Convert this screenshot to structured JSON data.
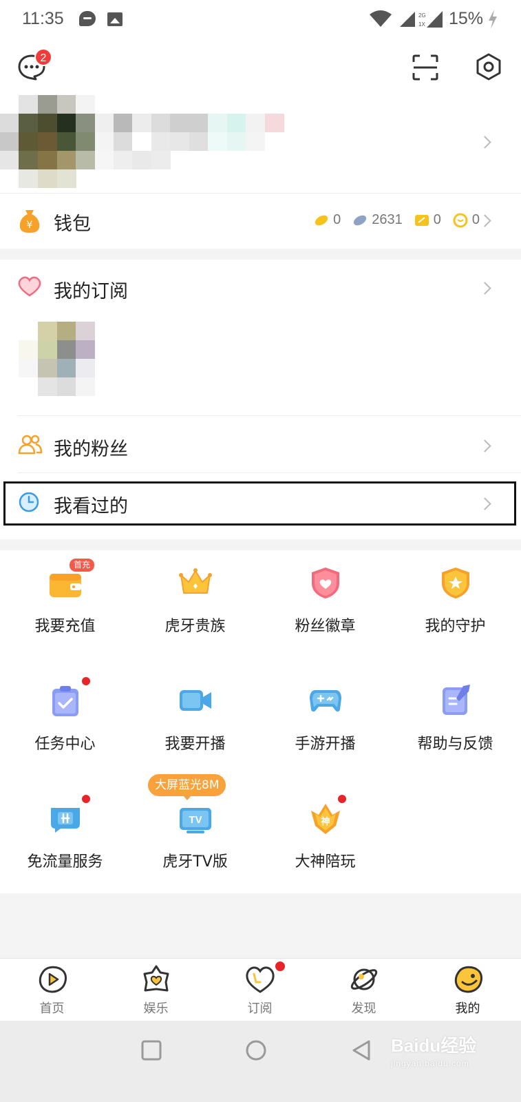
{
  "status_bar": {
    "time": "11:35",
    "battery": "15%",
    "network_top": "2G",
    "network_bottom": "1X"
  },
  "header": {
    "message_badge": "2"
  },
  "wallet": {
    "label": "钱包",
    "stats": [
      "0",
      "2631",
      "0",
      "0"
    ]
  },
  "subscriptions": {
    "label": "我的订阅"
  },
  "fans": {
    "label": "我的粉丝"
  },
  "history": {
    "label": "我看过的"
  },
  "features": [
    {
      "label": "我要充值",
      "tag": "首充",
      "icon": "wallet-icon"
    },
    {
      "label": "虎牙贵族",
      "icon": "crown-icon"
    },
    {
      "label": "粉丝徽章",
      "icon": "fan-badge-icon"
    },
    {
      "label": "我的守护",
      "icon": "guard-shield-icon"
    },
    {
      "label": "任务中心",
      "icon": "task-clipboard-icon",
      "dot": true
    },
    {
      "label": "我要开播",
      "icon": "video-camera-icon"
    },
    {
      "label": "手游开播",
      "icon": "gamepad-icon"
    },
    {
      "label": "帮助与反馈",
      "icon": "feedback-edit-icon"
    },
    {
      "label": "免流量服务",
      "icon": "free-data-icon",
      "dot": true
    },
    {
      "label": "虎牙TV版",
      "tag": "大屏蓝光8M",
      "icon": "tv-icon"
    },
    {
      "label": "大神陪玩",
      "icon": "master-play-icon",
      "dot": true
    }
  ],
  "tabbar": [
    {
      "label": "首页",
      "icon": "home-play-icon"
    },
    {
      "label": "娱乐",
      "icon": "entertainment-star-icon"
    },
    {
      "label": "订阅",
      "icon": "subscribe-heart-icon",
      "dot": true
    },
    {
      "label": "发现",
      "icon": "discover-planet-icon"
    },
    {
      "label": "我的",
      "icon": "me-face-icon",
      "active": true
    }
  ],
  "watermark": {
    "brand": "Baidu经验",
    "sub": "jingyan.baidu.com"
  },
  "colors": {
    "accent": "#f9a13a",
    "red": "#e8242b",
    "blue": "#4aa8e6"
  }
}
